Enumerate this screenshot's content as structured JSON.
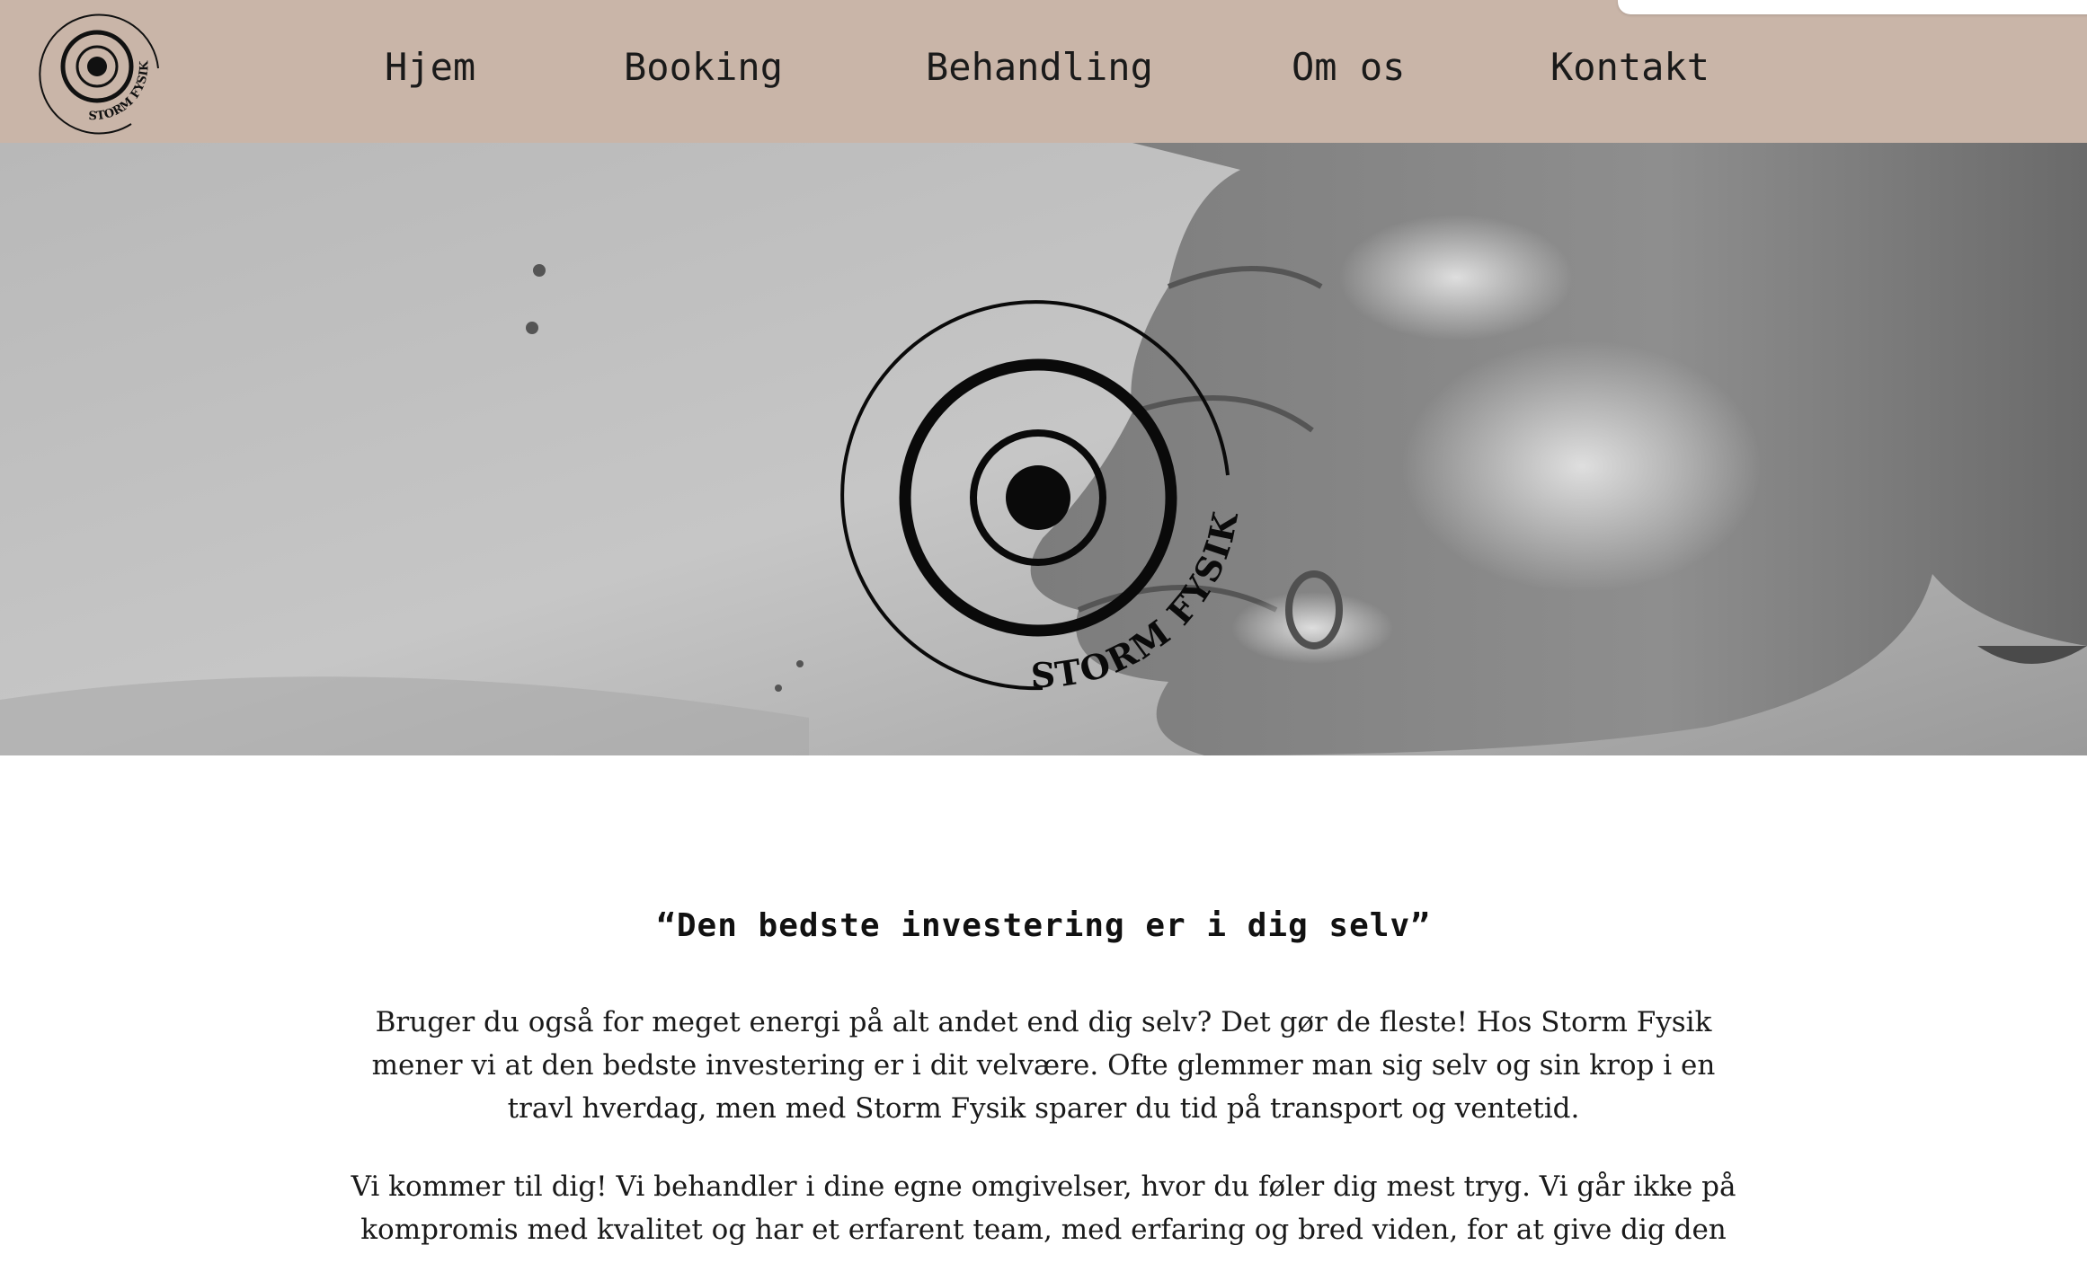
{
  "nav": {
    "logo_alt": "STORM FYSIK",
    "links": [
      "Hjem",
      "Booking",
      "Behandling",
      "Om os",
      "Kontakt"
    ]
  },
  "hero": {
    "logo_text": "STORM FYSIK",
    "image_description": "black and white massage photo"
  },
  "content": {
    "quote": "“Den bedste investering er i dig selv”",
    "paragraph_1": "Bruger du også for meget energi på alt andet end dig selv? Det gør de fleste! Hos Storm Fysik mener vi at den bedste investering er i dit velvære. Ofte glemmer man sig selv og sin krop i en travl hverdag, men med Storm Fysik sparer du tid på transport og ventetid.",
    "paragraph_2": "Vi kommer til dig! Vi behandler i dine egne omgivelser, hvor du føler dig mest tryg. Vi går ikke på kompromis med kvalitet og har et erfarent team, med erfaring og bred viden, for at give dig den"
  },
  "colors": {
    "nav_bg": "#c9b5a8",
    "text": "#1a1a1a",
    "page_bg": "#ffffff"
  }
}
